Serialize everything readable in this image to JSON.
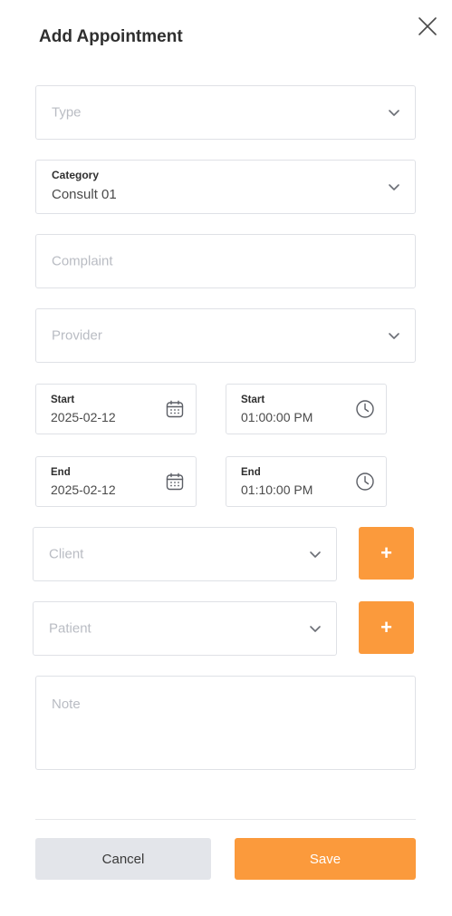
{
  "dialog": {
    "title": "Add Appointment",
    "close_icon": "close-icon"
  },
  "form": {
    "type": {
      "placeholder": "Type",
      "value": ""
    },
    "category": {
      "label": "Category",
      "value": "Consult 01"
    },
    "complaint": {
      "placeholder": "Complaint",
      "value": ""
    },
    "provider": {
      "placeholder": "Provider",
      "value": ""
    },
    "start_date": {
      "label": "Start",
      "value": "2025-02-12",
      "icon": "calendar-icon"
    },
    "start_time": {
      "label": "Start",
      "value": "01:00:00 PM",
      "icon": "clock-icon"
    },
    "end_date": {
      "label": "End",
      "value": "2025-02-12",
      "icon": "calendar-icon"
    },
    "end_time": {
      "label": "End",
      "value": "01:10:00 PM",
      "icon": "clock-icon"
    },
    "client": {
      "placeholder": "Client",
      "add_label": "+"
    },
    "patient": {
      "placeholder": "Patient",
      "add_label": "+"
    },
    "note": {
      "placeholder": "Note",
      "value": ""
    }
  },
  "actions": {
    "cancel_label": "Cancel",
    "save_label": "Save"
  },
  "colors": {
    "accent": "#fb9a3c",
    "cancel_bg": "#e3e5ea",
    "border": "#dfe1e6",
    "placeholder": "#b9bcc3"
  }
}
